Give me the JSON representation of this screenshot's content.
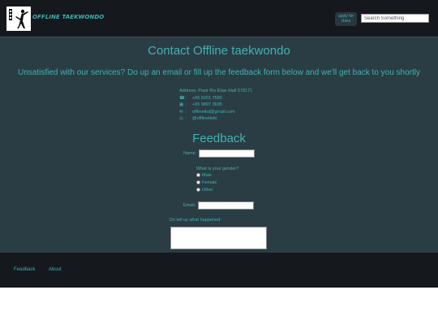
{
  "header": {
    "brand": "OFFLINE TAEKWONDO",
    "apply_line1": "apply for",
    "apply_line2": "class",
    "search_placeholder": "Search Something"
  },
  "main": {
    "title": "Contact Offline taekwondo",
    "subtitle": "Unsatisfied with our services? Do up an email or fill up the feedback form below and we'll get back to you shortly",
    "contact": {
      "address": "Address: Pasir Ris Elias Mall 578171",
      "phone": "+65 6201 7580",
      "mobile": "+65 9897 3695",
      "email": "offlinetkd@gmail.com",
      "social": "@offlinetkdo"
    },
    "contact_sep": ":",
    "contact_icons": {
      "phone": "☎",
      "mobile": "▦",
      "email": "✉",
      "social": "◎"
    }
  },
  "feedback": {
    "title": "Feedback",
    "name_label": "Name:",
    "gender_question": "What is your gender?",
    "gender_options": [
      "Male",
      "Female",
      "Other"
    ],
    "email_label": "Email:",
    "tell_label": "Do tell us what happened:"
  },
  "footer": {
    "links": [
      "Feedback",
      "About"
    ]
  },
  "colors": {
    "accent": "#3fb2b2",
    "header_bg": "#15191d",
    "main_bg": "#2b3d44"
  }
}
